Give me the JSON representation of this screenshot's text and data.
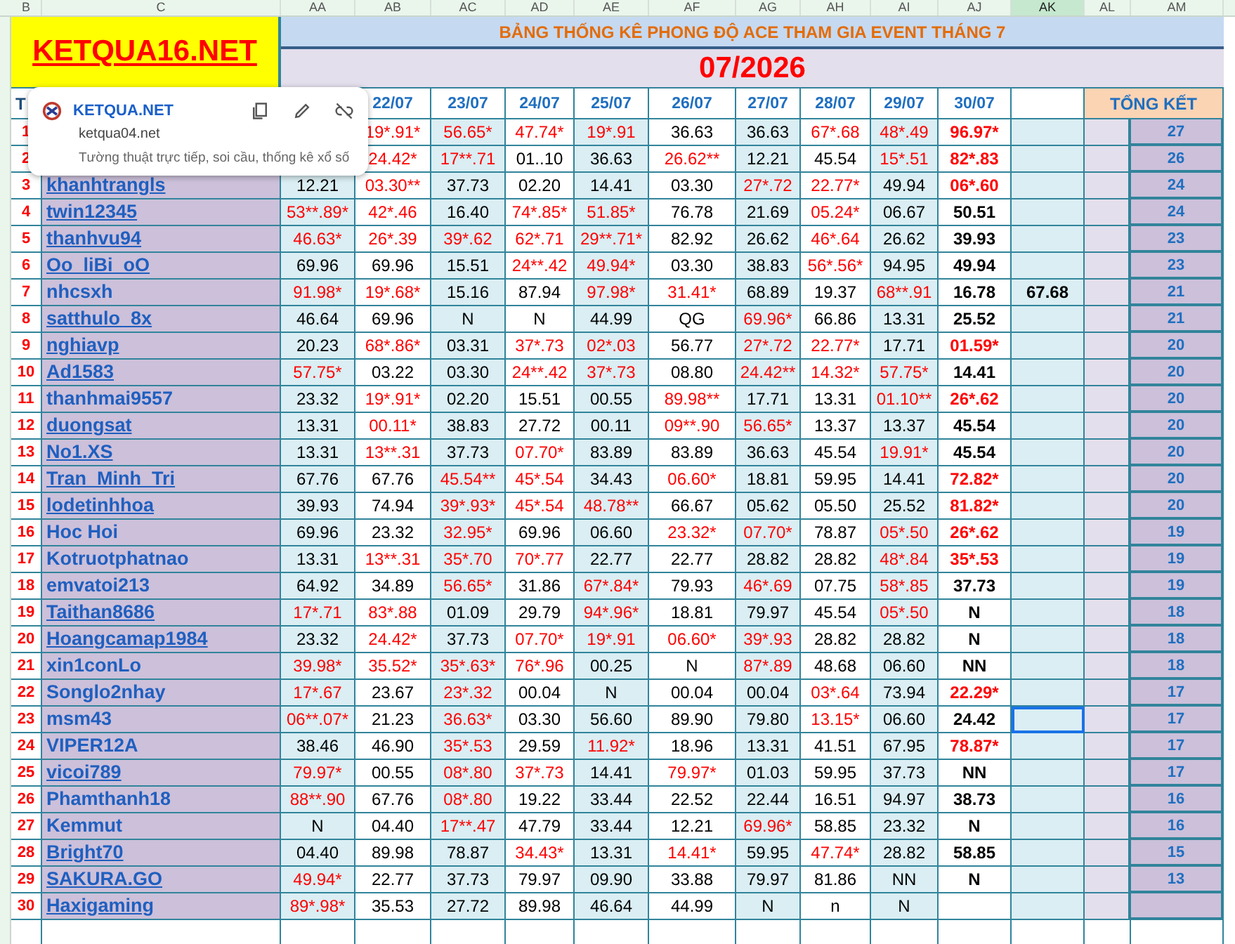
{
  "column_letters": [
    {
      "label": "B",
      "selected": false
    },
    {
      "label": "C",
      "selected": false
    },
    {
      "label": "AA",
      "selected": false
    },
    {
      "label": "AB",
      "selected": false
    },
    {
      "label": "AC",
      "selected": false
    },
    {
      "label": "AD",
      "selected": false
    },
    {
      "label": "AE",
      "selected": false
    },
    {
      "label": "AF",
      "selected": false
    },
    {
      "label": "AG",
      "selected": false
    },
    {
      "label": "AH",
      "selected": false
    },
    {
      "label": "AI",
      "selected": false
    },
    {
      "label": "AJ",
      "selected": false
    },
    {
      "label": "AK",
      "selected": true
    },
    {
      "label": "AL",
      "selected": false
    },
    {
      "label": "AM",
      "selected": false
    }
  ],
  "logo": "KETQUA16.NET",
  "title": "BẢNG THỐNG KÊ PHONG ĐỘ ACE THAM GIA EVENT THÁNG 7",
  "period": "07/2026",
  "header": {
    "col_b": "T",
    "dates": [
      "22/07",
      "23/07",
      "24/07",
      "25/07",
      "26/07",
      "27/07",
      "28/07",
      "29/07",
      "30/07"
    ],
    "summary": "TỔNG KẾT"
  },
  "rows": [
    {
      "no": "1",
      "ak_selected": false,
      "score": "27",
      "cells": [
        {
          "v": "19*.91*",
          "hit": true
        },
        {
          "v": "56.65*",
          "hit": true
        },
        {
          "v": "47.74*",
          "hit": true
        },
        {
          "v": "19*.91",
          "hit": true
        },
        {
          "v": "36.63",
          "hit": false
        },
        {
          "v": "36.63",
          "hit": false
        },
        {
          "v": "67*.68",
          "hit": true
        },
        {
          "v": "48*.49",
          "hit": true
        },
        {
          "v": "96.97*",
          "hit": true
        }
      ]
    },
    {
      "no": "2",
      "ak_selected": false,
      "score": "26",
      "cells": [
        {
          "v": "24.42*",
          "hit": true
        },
        {
          "v": "17**.71",
          "hit": true
        },
        {
          "v": "01..10",
          "hit": false
        },
        {
          "v": "36.63",
          "hit": false
        },
        {
          "v": "26.62**",
          "hit": true
        },
        {
          "v": "12.21",
          "hit": false
        },
        {
          "v": "45.54",
          "hit": false
        },
        {
          "v": "15*.51",
          "hit": true
        },
        {
          "v": "82*.83",
          "hit": true
        }
      ]
    },
    {
      "no": "3",
      "name": "khanhtrangls",
      "linked": true,
      "ak_selected": false,
      "score": "24",
      "cells": [
        {
          "v": "12.21",
          "hit": false
        },
        {
          "v": "03.30**",
          "hit": true
        },
        {
          "v": "37.73",
          "hit": false
        },
        {
          "v": "02.20",
          "hit": false
        },
        {
          "v": "14.41",
          "hit": false
        },
        {
          "v": "03.30",
          "hit": false
        },
        {
          "v": "27*.72",
          "hit": true
        },
        {
          "v": "22.77*",
          "hit": true
        },
        {
          "v": "49.94",
          "hit": false
        },
        {
          "v": "06*.60",
          "hit": true
        }
      ]
    },
    {
      "no": "4",
      "name": "twin12345",
      "linked": true,
      "ak_selected": false,
      "score": "24",
      "cells": [
        {
          "v": "53**.89*",
          "hit": true
        },
        {
          "v": "42*.46",
          "hit": true
        },
        {
          "v": "16.40",
          "hit": false
        },
        {
          "v": "74*.85*",
          "hit": true
        },
        {
          "v": "51.85*",
          "hit": true
        },
        {
          "v": "76.78",
          "hit": false
        },
        {
          "v": "21.69",
          "hit": false
        },
        {
          "v": "05.24*",
          "hit": true
        },
        {
          "v": "06.67",
          "hit": false
        },
        {
          "v": "50.51",
          "hit": false
        }
      ]
    },
    {
      "no": "5",
      "name": "thanhvu94",
      "linked": true,
      "ak_selected": false,
      "score": "23",
      "cells": [
        {
          "v": "46.63*",
          "hit": true
        },
        {
          "v": "26*.39",
          "hit": true
        },
        {
          "v": "39*.62",
          "hit": true
        },
        {
          "v": "62*.71",
          "hit": true
        },
        {
          "v": "29**.71*",
          "hit": true
        },
        {
          "v": "82.92",
          "hit": false
        },
        {
          "v": "26.62",
          "hit": false
        },
        {
          "v": "46*.64",
          "hit": true
        },
        {
          "v": "26.62",
          "hit": false
        },
        {
          "v": "39.93",
          "hit": false
        }
      ]
    },
    {
      "no": "6",
      "name": "Oo_liBi_oO",
      "linked": true,
      "ak_selected": false,
      "score": "23",
      "cells": [
        {
          "v": "69.96",
          "hit": false
        },
        {
          "v": "69.96",
          "hit": false
        },
        {
          "v": "15.51",
          "hit": false
        },
        {
          "v": "24**.42",
          "hit": true
        },
        {
          "v": "49.94*",
          "hit": true
        },
        {
          "v": "03.30",
          "hit": false
        },
        {
          "v": "38.83",
          "hit": false
        },
        {
          "v": "56*.56*",
          "hit": true
        },
        {
          "v": "94.95",
          "hit": false
        },
        {
          "v": "49.94",
          "hit": false
        }
      ]
    },
    {
      "no": "7",
      "name": "nhcsxh",
      "linked": false,
      "ak": "67.68",
      "ak_selected": false,
      "score": "21",
      "cells": [
        {
          "v": "91.98*",
          "hit": true
        },
        {
          "v": "19*.68*",
          "hit": true
        },
        {
          "v": "15.16",
          "hit": false
        },
        {
          "v": "87.94",
          "hit": false
        },
        {
          "v": "97.98*",
          "hit": true
        },
        {
          "v": "31.41*",
          "hit": true
        },
        {
          "v": "68.89",
          "hit": false
        },
        {
          "v": "19.37",
          "hit": false
        },
        {
          "v": "68**.91",
          "hit": true
        },
        {
          "v": "16.78",
          "hit": false
        }
      ]
    },
    {
      "no": "8",
      "name": "satthulo_8x",
      "linked": true,
      "ak_selected": false,
      "score": "21",
      "cells": [
        {
          "v": "46.64",
          "hit": false
        },
        {
          "v": "69.96",
          "hit": false
        },
        {
          "v": "N",
          "hit": false
        },
        {
          "v": "N",
          "hit": false
        },
        {
          "v": "44.99",
          "hit": false
        },
        {
          "v": "QG",
          "hit": false
        },
        {
          "v": "69.96*",
          "hit": true
        },
        {
          "v": "66.86",
          "hit": false
        },
        {
          "v": "13.31",
          "hit": false
        },
        {
          "v": "25.52",
          "hit": false
        }
      ]
    },
    {
      "no": "9",
      "name": "nghiavp",
      "linked": true,
      "ak_selected": false,
      "score": "20",
      "cells": [
        {
          "v": "20.23",
          "hit": false
        },
        {
          "v": "68*.86*",
          "hit": true
        },
        {
          "v": "03.31",
          "hit": false
        },
        {
          "v": "37*.73",
          "hit": true
        },
        {
          "v": "02*.03",
          "hit": true
        },
        {
          "v": "56.77",
          "hit": false
        },
        {
          "v": "27*.72",
          "hit": true
        },
        {
          "v": "22.77*",
          "hit": true
        },
        {
          "v": "17.71",
          "hit": false
        },
        {
          "v": "01.59*",
          "hit": true
        }
      ]
    },
    {
      "no": "10",
      "name": "Ad1583",
      "linked": true,
      "ak_selected": false,
      "score": "20",
      "cells": [
        {
          "v": "57.75*",
          "hit": true
        },
        {
          "v": "03.22",
          "hit": false
        },
        {
          "v": "03.30",
          "hit": false
        },
        {
          "v": "24**.42",
          "hit": true
        },
        {
          "v": "37*.73",
          "hit": true
        },
        {
          "v": "08.80",
          "hit": false
        },
        {
          "v": "24.42**",
          "hit": true
        },
        {
          "v": "14.32*",
          "hit": true
        },
        {
          "v": "57.75*",
          "hit": true
        },
        {
          "v": "14.41",
          "hit": false
        }
      ]
    },
    {
      "no": "11",
      "name": "thanhmai9557",
      "linked": false,
      "ak_selected": false,
      "score": "20",
      "cells": [
        {
          "v": "23.32",
          "hit": false
        },
        {
          "v": "19*.91*",
          "hit": true
        },
        {
          "v": "02.20",
          "hit": false
        },
        {
          "v": "15.51",
          "hit": false
        },
        {
          "v": "00.55",
          "hit": false
        },
        {
          "v": "89.98**",
          "hit": true
        },
        {
          "v": "17.71",
          "hit": false
        },
        {
          "v": "13.31",
          "hit": false
        },
        {
          "v": "01.10**",
          "hit": true
        },
        {
          "v": "26*.62",
          "hit": true
        }
      ]
    },
    {
      "no": "12",
      "name": "duongsat",
      "linked": true,
      "ak_selected": false,
      "score": "20",
      "cells": [
        {
          "v": "13.31",
          "hit": false
        },
        {
          "v": "00.11*",
          "hit": true
        },
        {
          "v": "38.83",
          "hit": false
        },
        {
          "v": "27.72",
          "hit": false
        },
        {
          "v": "00.11",
          "hit": false
        },
        {
          "v": "09**.90",
          "hit": true
        },
        {
          "v": "56.65*",
          "hit": true
        },
        {
          "v": "13.37",
          "hit": false
        },
        {
          "v": "13.37",
          "hit": false
        },
        {
          "v": "45.54",
          "hit": false
        }
      ]
    },
    {
      "no": "13",
      "name": "No1.XS",
      "linked": true,
      "ak_selected": false,
      "score": "20",
      "cells": [
        {
          "v": "13.31",
          "hit": false
        },
        {
          "v": "13**.31",
          "hit": true
        },
        {
          "v": "37.73",
          "hit": false
        },
        {
          "v": "07.70*",
          "hit": true
        },
        {
          "v": "83.89",
          "hit": false
        },
        {
          "v": "83.89",
          "hit": false
        },
        {
          "v": "36.63",
          "hit": false
        },
        {
          "v": "45.54",
          "hit": false
        },
        {
          "v": "19.91*",
          "hit": true
        },
        {
          "v": "45.54",
          "hit": false
        }
      ]
    },
    {
      "no": "14",
      "name": "Tran_Minh_Tri",
      "linked": true,
      "ak_selected": false,
      "score": "20",
      "cells": [
        {
          "v": "67.76",
          "hit": false
        },
        {
          "v": "67.76",
          "hit": false
        },
        {
          "v": "45.54**",
          "hit": true
        },
        {
          "v": "45*.54",
          "hit": true
        },
        {
          "v": "34.43",
          "hit": false
        },
        {
          "v": "06.60*",
          "hit": true
        },
        {
          "v": "18.81",
          "hit": false
        },
        {
          "v": "59.95",
          "hit": false
        },
        {
          "v": "14.41",
          "hit": false
        },
        {
          "v": "72.82*",
          "hit": true
        }
      ]
    },
    {
      "no": "15",
      "name": "lodetinhhoa",
      "linked": true,
      "ak_selected": false,
      "score": "20",
      "cells": [
        {
          "v": "39.93",
          "hit": false
        },
        {
          "v": "74.94",
          "hit": false
        },
        {
          "v": "39*.93*",
          "hit": true
        },
        {
          "v": "45*.54",
          "hit": true
        },
        {
          "v": "48.78**",
          "hit": true
        },
        {
          "v": "66.67",
          "hit": false
        },
        {
          "v": "05.62",
          "hit": false
        },
        {
          "v": "05.50",
          "hit": false
        },
        {
          "v": "25.52",
          "hit": false
        },
        {
          "v": "81.82*",
          "hit": true
        }
      ]
    },
    {
      "no": "16",
      "name": "Hoc Hoi",
      "linked": false,
      "ak_selected": false,
      "score": "19",
      "cells": [
        {
          "v": "69.96",
          "hit": false
        },
        {
          "v": "23.32",
          "hit": false
        },
        {
          "v": "32.95*",
          "hit": true
        },
        {
          "v": "69.96",
          "hit": false
        },
        {
          "v": "06.60",
          "hit": false
        },
        {
          "v": "23.32*",
          "hit": true
        },
        {
          "v": "07.70*",
          "hit": true
        },
        {
          "v": "78.87",
          "hit": false
        },
        {
          "v": "05*.50",
          "hit": true
        },
        {
          "v": "26*.62",
          "hit": true
        }
      ]
    },
    {
      "no": "17",
      "name": "Kotruotphatnao",
      "linked": false,
      "ak_selected": false,
      "score": "19",
      "cells": [
        {
          "v": "13.31",
          "hit": false
        },
        {
          "v": "13**.31",
          "hit": true
        },
        {
          "v": "35*.70",
          "hit": true
        },
        {
          "v": "70*.77",
          "hit": true
        },
        {
          "v": "22.77",
          "hit": false
        },
        {
          "v": "22.77",
          "hit": false
        },
        {
          "v": "28.82",
          "hit": false
        },
        {
          "v": "28.82",
          "hit": false
        },
        {
          "v": "48*.84",
          "hit": true
        },
        {
          "v": "35*.53",
          "hit": true
        }
      ]
    },
    {
      "no": "18",
      "name": "emvatoi213",
      "linked": false,
      "ak_selected": false,
      "score": "19",
      "cells": [
        {
          "v": "64.92",
          "hit": false
        },
        {
          "v": "34.89",
          "hit": false
        },
        {
          "v": "56.65*",
          "hit": true
        },
        {
          "v": "31.86",
          "hit": false
        },
        {
          "v": "67*.84*",
          "hit": true
        },
        {
          "v": "79.93",
          "hit": false
        },
        {
          "v": "46*.69",
          "hit": true
        },
        {
          "v": "07.75",
          "hit": false
        },
        {
          "v": "58*.85",
          "hit": true
        },
        {
          "v": "37.73",
          "hit": false
        }
      ]
    },
    {
      "no": "19",
      "name": "Taithan8686",
      "linked": true,
      "ak_selected": false,
      "score": "18",
      "cells": [
        {
          "v": "17*.71",
          "hit": true
        },
        {
          "v": "83*.88",
          "hit": true
        },
        {
          "v": "01.09",
          "hit": false
        },
        {
          "v": "29.79",
          "hit": false
        },
        {
          "v": "94*.96*",
          "hit": true
        },
        {
          "v": "18.81",
          "hit": false
        },
        {
          "v": "79.97",
          "hit": false
        },
        {
          "v": "45.54",
          "hit": false
        },
        {
          "v": "05*.50",
          "hit": true
        },
        {
          "v": "N",
          "hit": false
        }
      ]
    },
    {
      "no": "20",
      "name": "Hoangcamap1984",
      "linked": true,
      "ak_selected": false,
      "score": "18",
      "cells": [
        {
          "v": "23.32",
          "hit": false
        },
        {
          "v": "24.42*",
          "hit": true
        },
        {
          "v": "37.73",
          "hit": false
        },
        {
          "v": "07.70*",
          "hit": true
        },
        {
          "v": "19*.91",
          "hit": true
        },
        {
          "v": "06.60*",
          "hit": true
        },
        {
          "v": "39*.93",
          "hit": true
        },
        {
          "v": "28.82",
          "hit": false
        },
        {
          "v": "28.82",
          "hit": false
        },
        {
          "v": "N",
          "hit": false
        }
      ]
    },
    {
      "no": "21",
      "name": "xin1conLo",
      "linked": false,
      "ak_selected": false,
      "score": "18",
      "cells": [
        {
          "v": "39.98*",
          "hit": true
        },
        {
          "v": "35.52*",
          "hit": true
        },
        {
          "v": "35*.63*",
          "hit": true
        },
        {
          "v": "76*.96",
          "hit": true
        },
        {
          "v": "00.25",
          "hit": false
        },
        {
          "v": "N",
          "hit": false
        },
        {
          "v": "87*.89",
          "hit": true
        },
        {
          "v": "48.68",
          "hit": false
        },
        {
          "v": "06.60",
          "hit": false
        },
        {
          "v": "NN",
          "hit": false
        }
      ]
    },
    {
      "no": "22",
      "name": "Songlo2nhay",
      "linked": false,
      "ak_selected": false,
      "score": "17",
      "cells": [
        {
          "v": "17*.67",
          "hit": true
        },
        {
          "v": "23.67",
          "hit": false
        },
        {
          "v": "23*.32",
          "hit": true
        },
        {
          "v": "00.04",
          "hit": false
        },
        {
          "v": "N",
          "hit": false
        },
        {
          "v": "00.04",
          "hit": false
        },
        {
          "v": "00.04",
          "hit": false
        },
        {
          "v": "03*.64",
          "hit": true
        },
        {
          "v": "73.94",
          "hit": false
        },
        {
          "v": "22.29*",
          "hit": true
        }
      ]
    },
    {
      "no": "23",
      "name": "msm43",
      "linked": false,
      "ak_selected": true,
      "score": "17",
      "cells": [
        {
          "v": "06**.07*",
          "hit": true
        },
        {
          "v": "21.23",
          "hit": false
        },
        {
          "v": "36.63*",
          "hit": true
        },
        {
          "v": "03.30",
          "hit": false
        },
        {
          "v": "56.60",
          "hit": false
        },
        {
          "v": "89.90",
          "hit": false
        },
        {
          "v": "79.80",
          "hit": false
        },
        {
          "v": "13.15*",
          "hit": true
        },
        {
          "v": "06.60",
          "hit": false
        },
        {
          "v": "24.42",
          "hit": false
        }
      ]
    },
    {
      "no": "24",
      "name": "VIPER12A",
      "linked": false,
      "ak_selected": false,
      "score": "17",
      "cells": [
        {
          "v": "38.46",
          "hit": false
        },
        {
          "v": "46.90",
          "hit": false
        },
        {
          "v": "35*.53",
          "hit": true
        },
        {
          "v": "29.59",
          "hit": false
        },
        {
          "v": "11.92*",
          "hit": true
        },
        {
          "v": "18.96",
          "hit": false
        },
        {
          "v": "13.31",
          "hit": false
        },
        {
          "v": "41.51",
          "hit": false
        },
        {
          "v": "67.95",
          "hit": false
        },
        {
          "v": "78.87*",
          "hit": true
        }
      ]
    },
    {
      "no": "25",
      "name": "vicoi789",
      "linked": true,
      "ak_selected": false,
      "score": "17",
      "cells": [
        {
          "v": "79.97*",
          "hit": true
        },
        {
          "v": "00.55",
          "hit": false
        },
        {
          "v": "08*.80",
          "hit": true
        },
        {
          "v": "37*.73",
          "hit": true
        },
        {
          "v": "14.41",
          "hit": false
        },
        {
          "v": "79.97*",
          "hit": true
        },
        {
          "v": "01.03",
          "hit": false
        },
        {
          "v": "59.95",
          "hit": false
        },
        {
          "v": "37.73",
          "hit": false
        },
        {
          "v": "NN",
          "hit": false
        }
      ]
    },
    {
      "no": "26",
      "name": "Phamthanh18",
      "linked": false,
      "ak_selected": false,
      "score": "16",
      "cells": [
        {
          "v": "88**.90",
          "hit": true
        },
        {
          "v": "67.76",
          "hit": false
        },
        {
          "v": "08*.80",
          "hit": true
        },
        {
          "v": "19.22",
          "hit": false
        },
        {
          "v": "33.44",
          "hit": false
        },
        {
          "v": "22.52",
          "hit": false
        },
        {
          "v": "22.44",
          "hit": false
        },
        {
          "v": "16.51",
          "hit": false
        },
        {
          "v": "94.97",
          "hit": false
        },
        {
          "v": "38.73",
          "hit": false
        }
      ]
    },
    {
      "no": "27",
      "name": "Kemmut",
      "linked": false,
      "ak_selected": false,
      "score": "16",
      "cells": [
        {
          "v": "N",
          "hit": false
        },
        {
          "v": "04.40",
          "hit": false
        },
        {
          "v": "17**.47",
          "hit": true
        },
        {
          "v": "47.79",
          "hit": false
        },
        {
          "v": "33.44",
          "hit": false
        },
        {
          "v": "12.21",
          "hit": false
        },
        {
          "v": "69.96*",
          "hit": true
        },
        {
          "v": "58.85",
          "hit": false
        },
        {
          "v": "23.32",
          "hit": false
        },
        {
          "v": "N",
          "hit": false
        }
      ]
    },
    {
      "no": "28",
      "name": "Bright70",
      "linked": true,
      "ak_selected": false,
      "score": "15",
      "cells": [
        {
          "v": "04.40",
          "hit": false
        },
        {
          "v": "89.98",
          "hit": false
        },
        {
          "v": "78.87",
          "hit": false
        },
        {
          "v": "34.43*",
          "hit": true
        },
        {
          "v": "13.31",
          "hit": false
        },
        {
          "v": "14.41*",
          "hit": true
        },
        {
          "v": "59.95",
          "hit": false
        },
        {
          "v": "47.74*",
          "hit": true
        },
        {
          "v": "28.82",
          "hit": false
        },
        {
          "v": "58.85",
          "hit": false
        }
      ]
    },
    {
      "no": "29",
      "name": "SAKURA.GO",
      "linked": true,
      "ak_selected": false,
      "score": "13",
      "cells": [
        {
          "v": "49.94*",
          "hit": true
        },
        {
          "v": "22.77",
          "hit": false
        },
        {
          "v": "37.73",
          "hit": false
        },
        {
          "v": "79.97",
          "hit": false
        },
        {
          "v": "09.90",
          "hit": false
        },
        {
          "v": "33.88",
          "hit": false
        },
        {
          "v": "79.97",
          "hit": false
        },
        {
          "v": "81.86",
          "hit": false
        },
        {
          "v": "NN",
          "hit": false
        },
        {
          "v": "N",
          "hit": false
        }
      ]
    },
    {
      "no": "30",
      "name": "Haxigaming",
      "linked": true,
      "ak_selected": false,
      "cells": [
        {
          "v": "89*.98*",
          "hit": true
        },
        {
          "v": "35.53",
          "hit": false
        },
        {
          "v": "27.72",
          "hit": false
        },
        {
          "v": "89.98",
          "hit": false
        },
        {
          "v": "46.64",
          "hit": false
        },
        {
          "v": "44.99",
          "hit": false
        },
        {
          "v": "N",
          "hit": false
        },
        {
          "v": "n",
          "hit": false
        },
        {
          "v": "N",
          "hit": false
        }
      ]
    }
  ],
  "link_popup": {
    "title": "KETQUA.NET",
    "url": "ketqua04.net",
    "description": "Tường thuật trực tiếp, soi cầu, thống kê xổ số"
  }
}
